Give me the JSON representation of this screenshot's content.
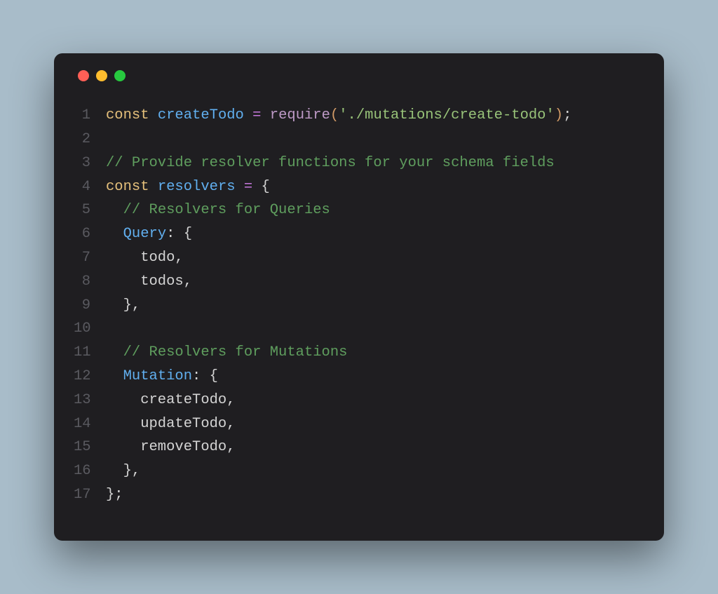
{
  "colors": {
    "background": "#a8bcc9",
    "window": "#1f1e21",
    "dot_red": "#ff5f56",
    "dot_yellow": "#ffbd2e",
    "dot_green": "#27c93f",
    "gutter": "#5a5a60",
    "keyword": "#e5c07b",
    "variable": "#61afef",
    "operator": "#c678dd",
    "function": "#be9ac7",
    "paren": "#d19a66",
    "string": "#98c379",
    "comment": "#5f9e5e",
    "plain": "#d4d4d4"
  },
  "lines": [
    {
      "num": "1",
      "tokens": [
        {
          "cls": "kw",
          "t": "const"
        },
        {
          "cls": "plain",
          "t": " "
        },
        {
          "cls": "var",
          "t": "createTodo"
        },
        {
          "cls": "plain",
          "t": " "
        },
        {
          "cls": "op",
          "t": "="
        },
        {
          "cls": "plain",
          "t": " "
        },
        {
          "cls": "fn",
          "t": "require"
        },
        {
          "cls": "paren",
          "t": "("
        },
        {
          "cls": "str",
          "t": "'./mutations/create-todo'"
        },
        {
          "cls": "paren",
          "t": ")"
        },
        {
          "cls": "plain",
          "t": ";"
        }
      ]
    },
    {
      "num": "2",
      "tokens": []
    },
    {
      "num": "3",
      "tokens": [
        {
          "cls": "comment",
          "t": "// Provide resolver functions for your schema fields"
        }
      ]
    },
    {
      "num": "4",
      "tokens": [
        {
          "cls": "kw",
          "t": "const"
        },
        {
          "cls": "plain",
          "t": " "
        },
        {
          "cls": "var",
          "t": "resolvers"
        },
        {
          "cls": "plain",
          "t": " "
        },
        {
          "cls": "op",
          "t": "="
        },
        {
          "cls": "plain",
          "t": " {"
        }
      ]
    },
    {
      "num": "5",
      "tokens": [
        {
          "cls": "plain",
          "t": "  "
        },
        {
          "cls": "comment",
          "t": "// Resolvers for Queries"
        }
      ]
    },
    {
      "num": "6",
      "tokens": [
        {
          "cls": "plain",
          "t": "  "
        },
        {
          "cls": "var",
          "t": "Query"
        },
        {
          "cls": "plain",
          "t": ": {"
        }
      ]
    },
    {
      "num": "7",
      "tokens": [
        {
          "cls": "plain",
          "t": "    todo,"
        }
      ]
    },
    {
      "num": "8",
      "tokens": [
        {
          "cls": "plain",
          "t": "    todos,"
        }
      ]
    },
    {
      "num": "9",
      "tokens": [
        {
          "cls": "plain",
          "t": "  },"
        }
      ]
    },
    {
      "num": "10",
      "tokens": []
    },
    {
      "num": "11",
      "tokens": [
        {
          "cls": "plain",
          "t": "  "
        },
        {
          "cls": "comment",
          "t": "// Resolvers for Mutations"
        }
      ]
    },
    {
      "num": "12",
      "tokens": [
        {
          "cls": "plain",
          "t": "  "
        },
        {
          "cls": "var",
          "t": "Mutation"
        },
        {
          "cls": "plain",
          "t": ": {"
        }
      ]
    },
    {
      "num": "13",
      "tokens": [
        {
          "cls": "plain",
          "t": "    createTodo,"
        }
      ]
    },
    {
      "num": "14",
      "tokens": [
        {
          "cls": "plain",
          "t": "    updateTodo,"
        }
      ]
    },
    {
      "num": "15",
      "tokens": [
        {
          "cls": "plain",
          "t": "    removeTodo,"
        }
      ]
    },
    {
      "num": "16",
      "tokens": [
        {
          "cls": "plain",
          "t": "  },"
        }
      ]
    },
    {
      "num": "17",
      "tokens": [
        {
          "cls": "plain",
          "t": "};"
        }
      ]
    }
  ]
}
